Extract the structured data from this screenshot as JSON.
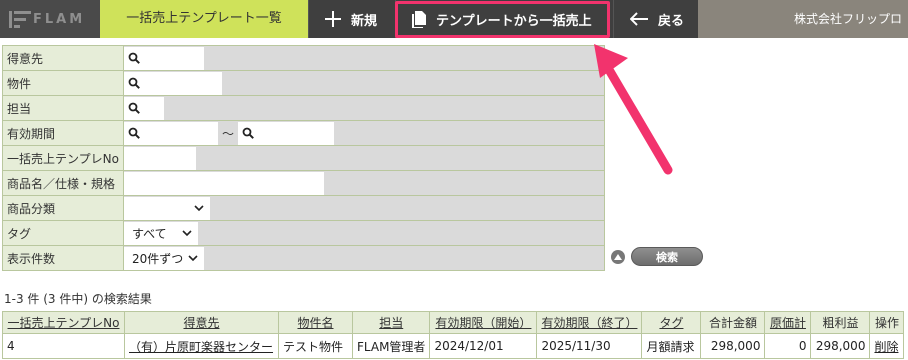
{
  "header": {
    "logo_text": "FLAM",
    "active_tab": "一括売上テンプレート一覧",
    "new_label": "新規",
    "bulk_label": "テンプレートから一括売上",
    "back_label": "戻る",
    "company": "株式会社フリップロ"
  },
  "form": {
    "rows": [
      {
        "label": "得意先",
        "type": "search"
      },
      {
        "label": "物件",
        "type": "search"
      },
      {
        "label": "担当",
        "type": "search"
      },
      {
        "label": "有効期間",
        "type": "range",
        "separator": "～"
      },
      {
        "label": "一括売上テンプレNo",
        "type": "text"
      },
      {
        "label": "商品名／仕様・規格",
        "type": "text"
      },
      {
        "label": "商品分類",
        "type": "select",
        "value": ""
      },
      {
        "label": "タグ",
        "type": "select",
        "value": "すべて"
      },
      {
        "label": "表示件数",
        "type": "select",
        "value": "20件ずつ"
      }
    ],
    "search_button": "検索"
  },
  "results": {
    "summary": "1-3 件 (3 件中) の検索結果",
    "columns": [
      "一括売上テンプレNo",
      "得意先",
      "物件名",
      "担当",
      "有効期限（開始）",
      "有効期限（終了）",
      "タグ",
      "合計金額",
      "原価計",
      "粗利益",
      "操作"
    ],
    "rows": [
      [
        "4",
        "（有）片原町楽器センター",
        "テスト物件",
        "FLAM管理者",
        "2024/12/01",
        "2025/11/30",
        "月額請求",
        "298,000",
        "0",
        "298,000",
        "削除"
      ]
    ]
  },
  "colors": {
    "accent_tab": "#cfe25a",
    "highlight": "#f2336d",
    "label_bg": "#e6edd8"
  }
}
